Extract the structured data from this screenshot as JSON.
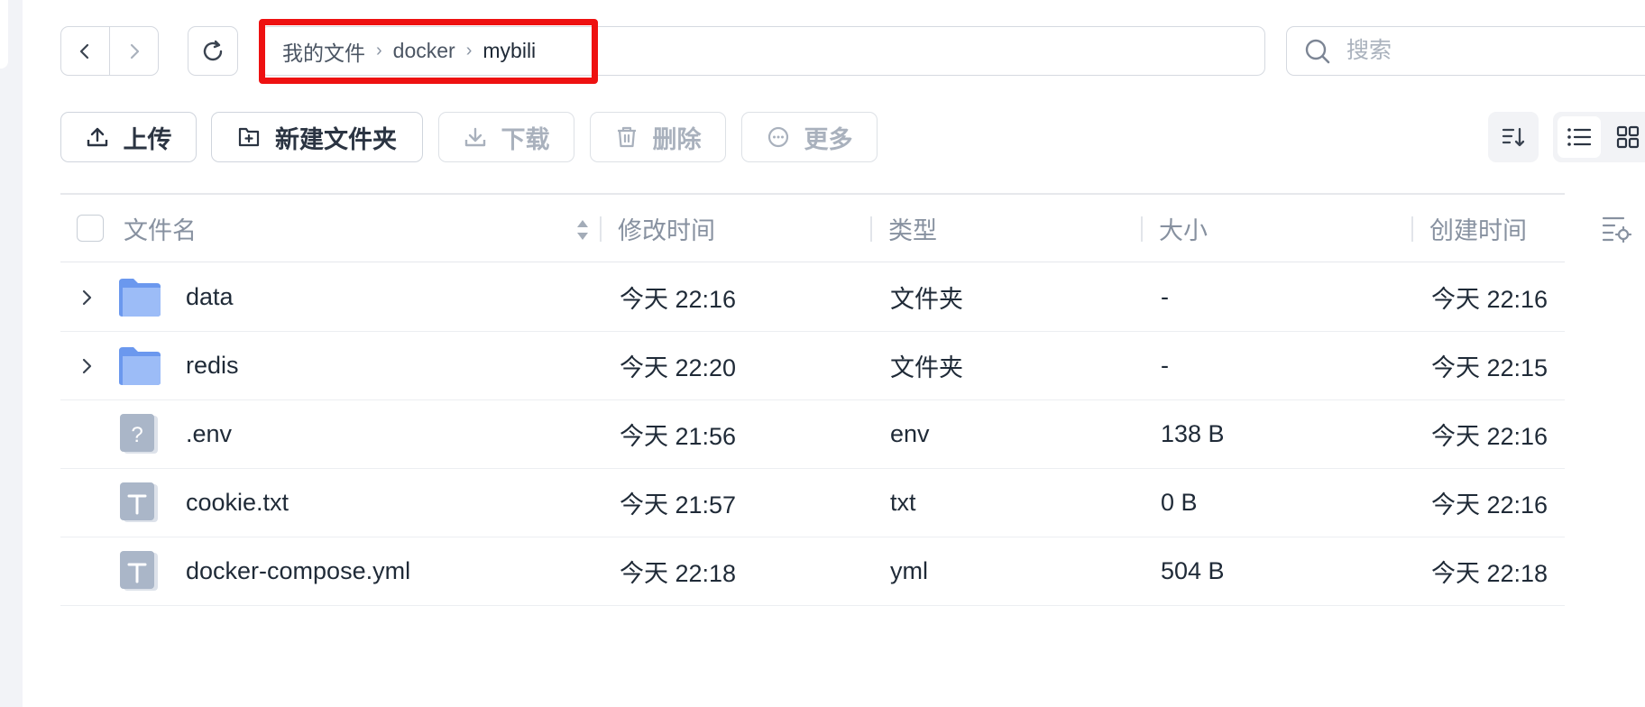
{
  "breadcrumb": {
    "items": [
      "我的文件",
      "docker"
    ],
    "current": "mybili"
  },
  "search": {
    "placeholder": "搜索"
  },
  "toolbar": {
    "upload": "上传",
    "new_folder": "新建文件夹",
    "download": "下载",
    "delete": "删除",
    "more": "更多"
  },
  "table": {
    "columns": {
      "name": "文件名",
      "modified": "修改时间",
      "type": "类型",
      "size": "大小",
      "created": "创建时间"
    },
    "rows": [
      {
        "name": "data",
        "modified": "今天 22:16",
        "type": "文件夹",
        "size": "-",
        "created": "今天 22:16",
        "icon": "folder-icon",
        "expandable": true
      },
      {
        "name": "redis",
        "modified": "今天 22:20",
        "type": "文件夹",
        "size": "-",
        "created": "今天 22:15",
        "icon": "folder-icon",
        "expandable": true
      },
      {
        "name": ".env",
        "modified": "今天 21:56",
        "type": "env",
        "size": "138 B",
        "created": "今天 22:16",
        "icon": "unknown-file-icon",
        "expandable": false
      },
      {
        "name": "cookie.txt",
        "modified": "今天 21:57",
        "type": "txt",
        "size": "0 B",
        "created": "今天 22:16",
        "icon": "text-file-icon",
        "expandable": false
      },
      {
        "name": "docker-compose.yml",
        "modified": "今天 22:18",
        "type": "yml",
        "size": "504 B",
        "created": "今天 22:18",
        "icon": "text-file-icon",
        "expandable": false
      }
    ]
  },
  "colors": {
    "highlight": "#ee1111",
    "folder": "#7fa8f5",
    "file": "#aab6c8",
    "border": "#d5d9e0"
  }
}
